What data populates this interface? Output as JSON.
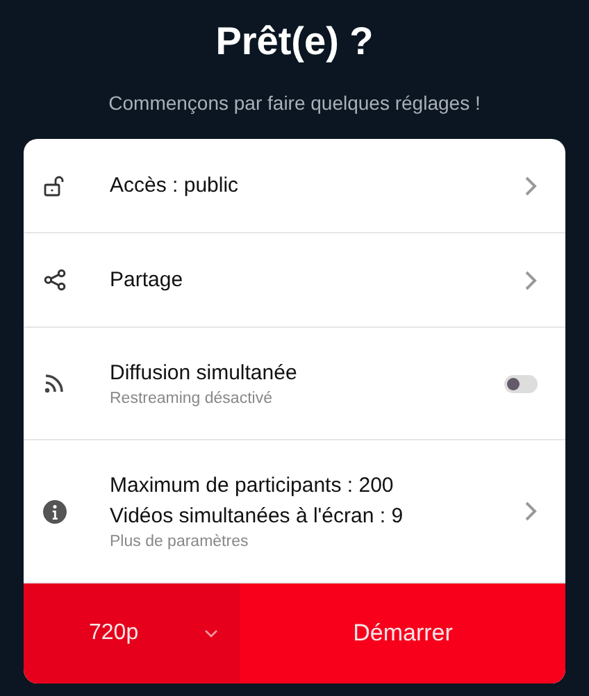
{
  "heading": {
    "title": "Prêt(e) ?",
    "subtitle": "Commençons par faire quelques réglages !"
  },
  "settings": [
    {
      "kind": "link",
      "lines": [
        "Accès : public"
      ]
    },
    {
      "kind": "link",
      "lines": [
        "Partage"
      ]
    },
    {
      "kind": "toggle",
      "lines": [
        "Diffusion simultanée"
      ],
      "note": "Restreaming désactivé",
      "on": false
    },
    {
      "kind": "link",
      "lines": [
        "Maximum de participants : 200",
        "Vidéos simultanées à l'écran : 9"
      ],
      "note": "Plus de paramètres"
    }
  ],
  "footer": {
    "quality": "720p",
    "start": "Démarrer"
  }
}
